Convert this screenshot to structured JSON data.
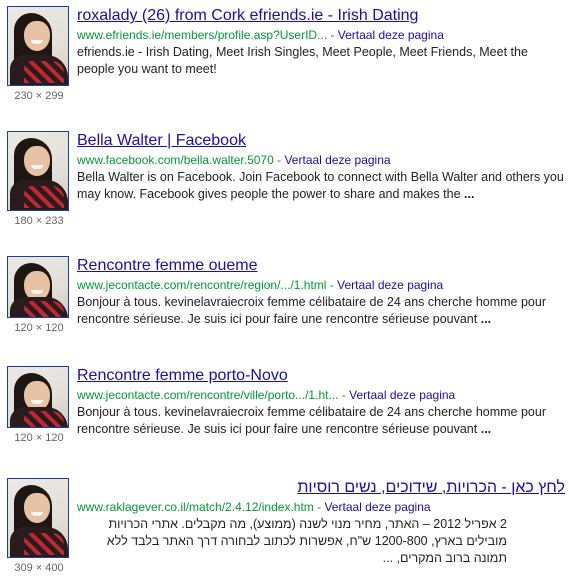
{
  "results": [
    {
      "title": "roxalady (26) from Cork efriends.ie - Irish Dating",
      "url": "www.efriends.ie/members/profile.asp?UserID...",
      "translate": "Vertaal deze pagina",
      "snippet": "efriends.ie - Irish Dating, Meet Irish Singles, Meet People, Meet Friends, Meet the people you want to meet!",
      "ellipsis": "",
      "dims": "230 × 299"
    },
    {
      "title": "Bella Walter | Facebook",
      "url": "www.facebook.com/bella.walter.5070",
      "translate": "Vertaal deze pagina",
      "snippet": "Bella Walter is on Facebook. Join Facebook to connect with Bella Walter and others you may know. Facebook gives people the power to share and makes the",
      "ellipsis": "...",
      "dims": "180 × 233"
    },
    {
      "title": "Rencontre femme oueme",
      "url": "www.jecontacte.com/rencontre/region/.../1.html",
      "translate": "Vertaal deze pagina",
      "snippet": "Bonjour à tous. kevinelavraiecroix femme célibataire de 24 ans cherche homme pour rencontre sérieuse. Je suis ici pour faire une rencontre sérieuse pouvant",
      "ellipsis": "...",
      "dims": "120 × 120"
    },
    {
      "title": "Rencontre femme porto-Novo",
      "url": "www.jecontacte.com/rencontre/ville/porto.../1.ht...",
      "translate": "Vertaal deze pagina",
      "snippet": "Bonjour à tous. kevinelavraiecroix femme célibataire de 24 ans cherche homme pour rencontre sérieuse. Je suis ici pour faire une rencontre sérieuse pouvant",
      "ellipsis": "...",
      "dims": "120 × 120"
    },
    {
      "title": "לחץ כאן - הכרויות, שידוכים, נשים רוסיות",
      "url": "www.raklagever.co.il/match/2.4.12/index.htm",
      "translate": "Vertaal deze pagina",
      "snippet": "2 אפריל 2012 – האתר, מחיר מנוי לשנה (ממוצע), מה מקבלים. אתרי הכרויות מובילים בארץ, 1200-800 ש\"ח, אפשרות לכתוב לבחורה דרך האתר בלבד ללא תמונה ברוב המקרים, ...",
      "ellipsis": "",
      "dims": "309 × 400"
    }
  ]
}
